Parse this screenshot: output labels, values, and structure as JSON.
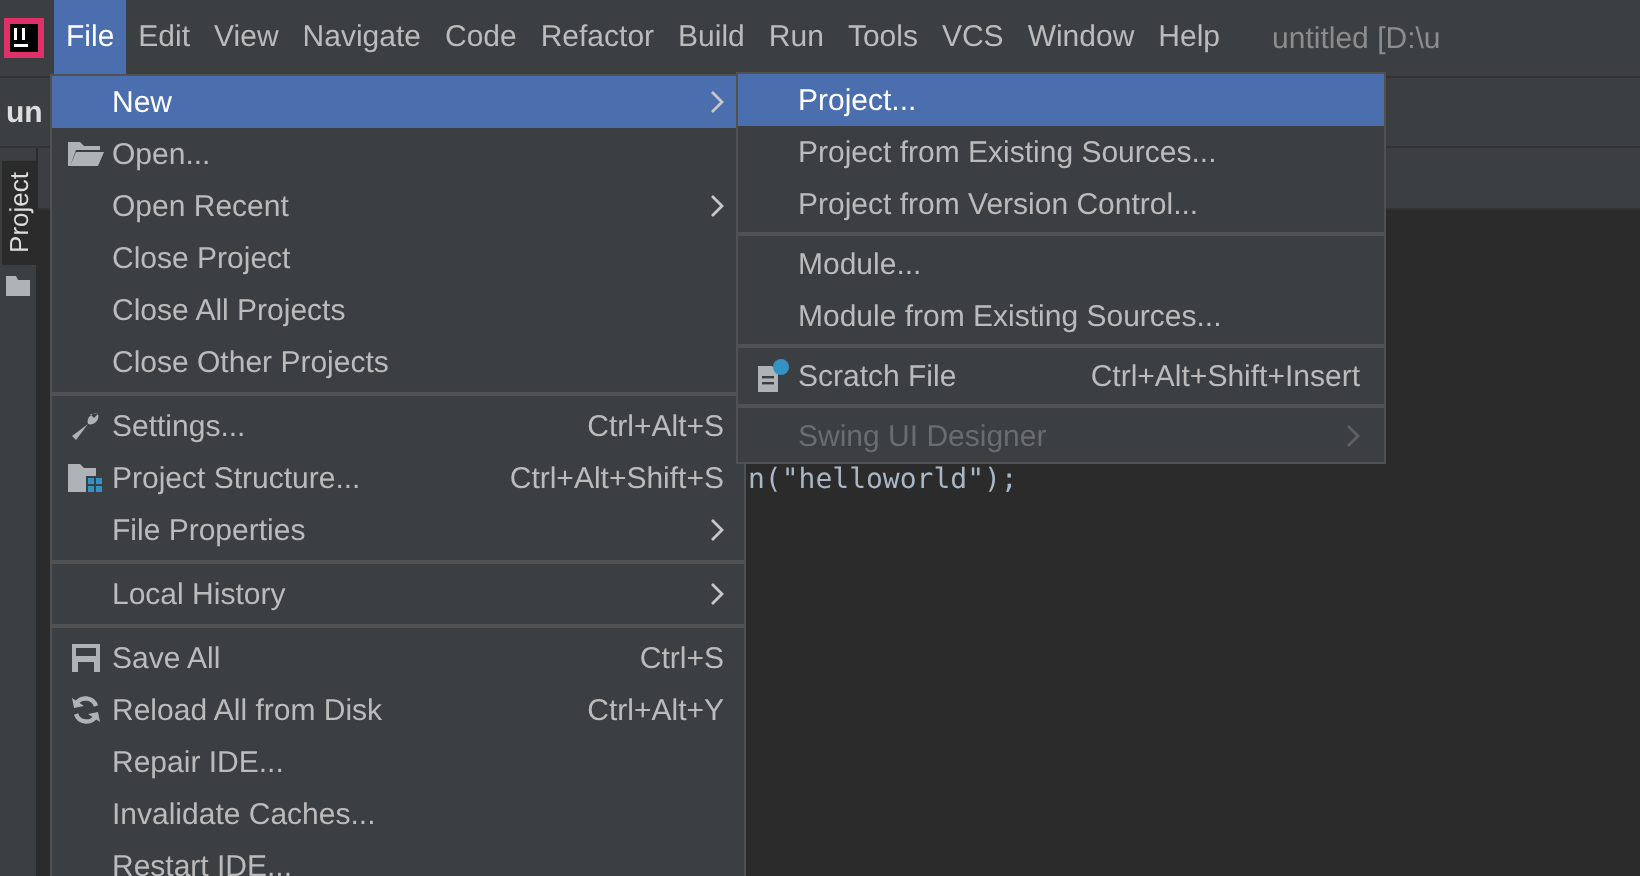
{
  "menu_bar": {
    "items": [
      {
        "label": "File",
        "selected": true
      },
      {
        "label": "Edit",
        "selected": false
      },
      {
        "label": "View",
        "selected": false
      },
      {
        "label": "Navigate",
        "selected": false
      },
      {
        "label": "Code",
        "selected": false
      },
      {
        "label": "Refactor",
        "selected": false
      },
      {
        "label": "Build",
        "selected": false
      },
      {
        "label": "Run",
        "selected": false
      },
      {
        "label": "Tools",
        "selected": false
      },
      {
        "label": "VCS",
        "selected": false
      },
      {
        "label": "Window",
        "selected": false
      },
      {
        "label": "Help",
        "selected": false
      }
    ],
    "window_title": "untitled [D:\\u"
  },
  "project_tab": "un",
  "tool_window_label": "Project",
  "editor": {
    "code_line": "n(\"helloworld\");"
  },
  "file_menu": {
    "items": [
      {
        "kind": "plain",
        "label": "New",
        "submenu": true,
        "selected": true
      },
      {
        "kind": "folder",
        "label": "Open...",
        "submenu": false,
        "selected": false
      },
      {
        "kind": "plain",
        "label": "Open Recent",
        "submenu": true,
        "selected": false
      },
      {
        "kind": "plain",
        "label": "Close Project",
        "submenu": false,
        "selected": false
      },
      {
        "kind": "plain",
        "label": "Close All Projects",
        "submenu": false,
        "selected": false
      },
      {
        "kind": "plain",
        "label": "Close Other Projects",
        "submenu": false,
        "selected": false
      },
      {
        "kind": "separator"
      },
      {
        "kind": "wrench",
        "label": "Settings...",
        "shortcut": "Ctrl+Alt+S",
        "submenu": false,
        "selected": false
      },
      {
        "kind": "structure",
        "label": "Project Structure...",
        "shortcut": "Ctrl+Alt+Shift+S",
        "submenu": false,
        "selected": false
      },
      {
        "kind": "plain",
        "label": "File Properties",
        "submenu": true,
        "selected": false
      },
      {
        "kind": "separator"
      },
      {
        "kind": "plain",
        "label": "Local History",
        "submenu": true,
        "selected": false
      },
      {
        "kind": "separator"
      },
      {
        "kind": "save",
        "label": "Save All",
        "shortcut": "Ctrl+S",
        "submenu": false,
        "selected": false
      },
      {
        "kind": "reload",
        "label": "Reload All from Disk",
        "shortcut": "Ctrl+Alt+Y",
        "submenu": false,
        "selected": false
      },
      {
        "kind": "plain",
        "label": "Repair IDE...",
        "submenu": false,
        "selected": false
      },
      {
        "kind": "plain",
        "label": "Invalidate Caches...",
        "submenu": false,
        "selected": false
      },
      {
        "kind": "plain",
        "label": "Restart IDE...",
        "submenu": false,
        "selected": false
      }
    ]
  },
  "new_submenu": {
    "items": [
      {
        "kind": "plain",
        "label": "Project...",
        "submenu": false,
        "selected": true,
        "disabled": false
      },
      {
        "kind": "plain",
        "label": "Project from Existing Sources...",
        "submenu": false,
        "selected": false,
        "disabled": false
      },
      {
        "kind": "plain",
        "label": "Project from Version Control...",
        "submenu": false,
        "selected": false,
        "disabled": false
      },
      {
        "kind": "separator"
      },
      {
        "kind": "plain",
        "label": "Module...",
        "submenu": false,
        "selected": false,
        "disabled": false
      },
      {
        "kind": "plain",
        "label": "Module from Existing Sources...",
        "submenu": false,
        "selected": false,
        "disabled": false
      },
      {
        "kind": "separator"
      },
      {
        "kind": "scratch",
        "label": "Scratch File",
        "shortcut": "Ctrl+Alt+Shift+Insert",
        "submenu": false,
        "selected": false,
        "disabled": false
      },
      {
        "kind": "separator"
      },
      {
        "kind": "plain",
        "label": "Swing UI Designer",
        "submenu": true,
        "selected": false,
        "disabled": true
      }
    ]
  }
}
